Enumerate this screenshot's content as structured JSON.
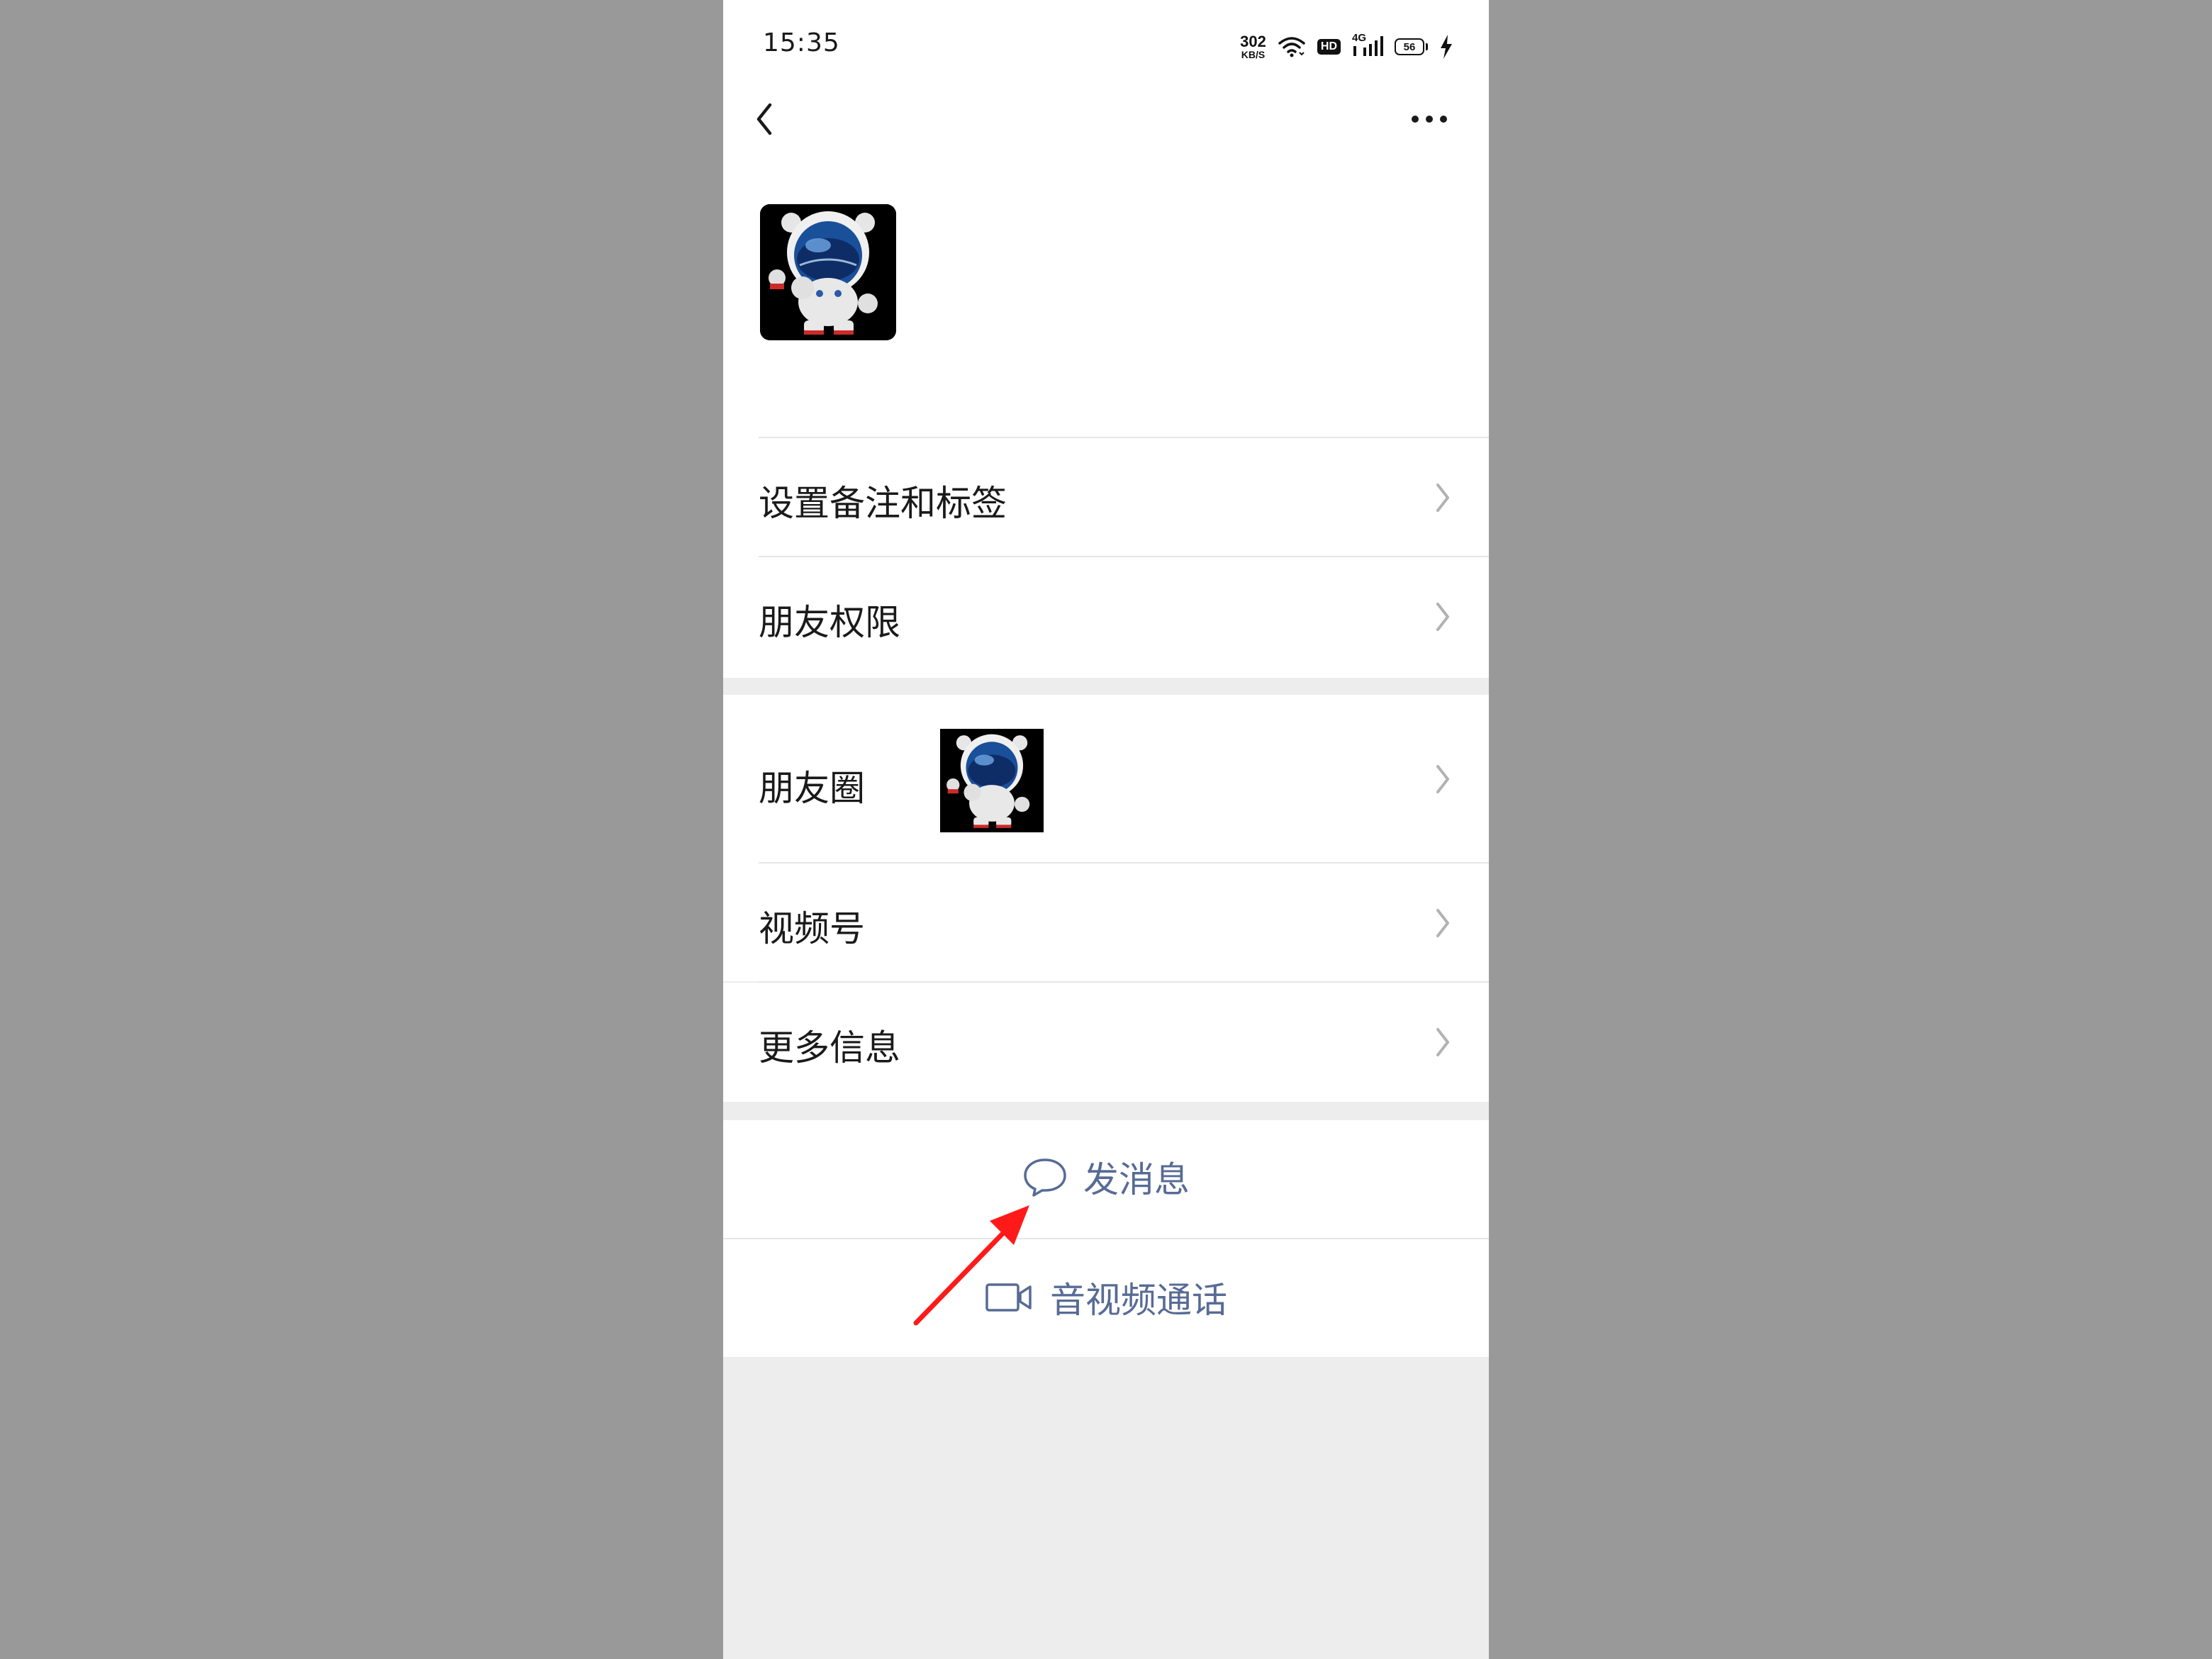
{
  "status_bar": {
    "time": "15:35",
    "net_speed_value": "302",
    "net_speed_unit": "KB/S",
    "hd_label": "HD",
    "network_label": "4G",
    "battery_level": "56",
    "icons": [
      "wifi-icon",
      "hd-icon",
      "signal-icon",
      "battery-icon",
      "charging-icon"
    ]
  },
  "nav": {
    "back_icon": "chevron-left-icon",
    "more_icon": "more-dots-icon"
  },
  "profile": {
    "avatar_icon": "astronaut-bear-avatar"
  },
  "menu_group_1": [
    {
      "label": "设置备注和标签"
    },
    {
      "label": "朋友权限"
    }
  ],
  "menu_group_2": [
    {
      "label": "朋友圈"
    },
    {
      "label": "视频号"
    },
    {
      "label": "更多信息"
    }
  ],
  "actions": {
    "send_message": {
      "label": "发消息",
      "icon": "chat-bubble-icon"
    },
    "av_call": {
      "label": "音视频通话",
      "icon": "video-camera-icon"
    }
  },
  "annotation": {
    "icon": "red-arrow-annotation",
    "color": "#ff0000"
  },
  "colors": {
    "background": "#999999",
    "page_background": "#ededed",
    "link_blue": "#576b95",
    "text": "#1a1a1a"
  }
}
